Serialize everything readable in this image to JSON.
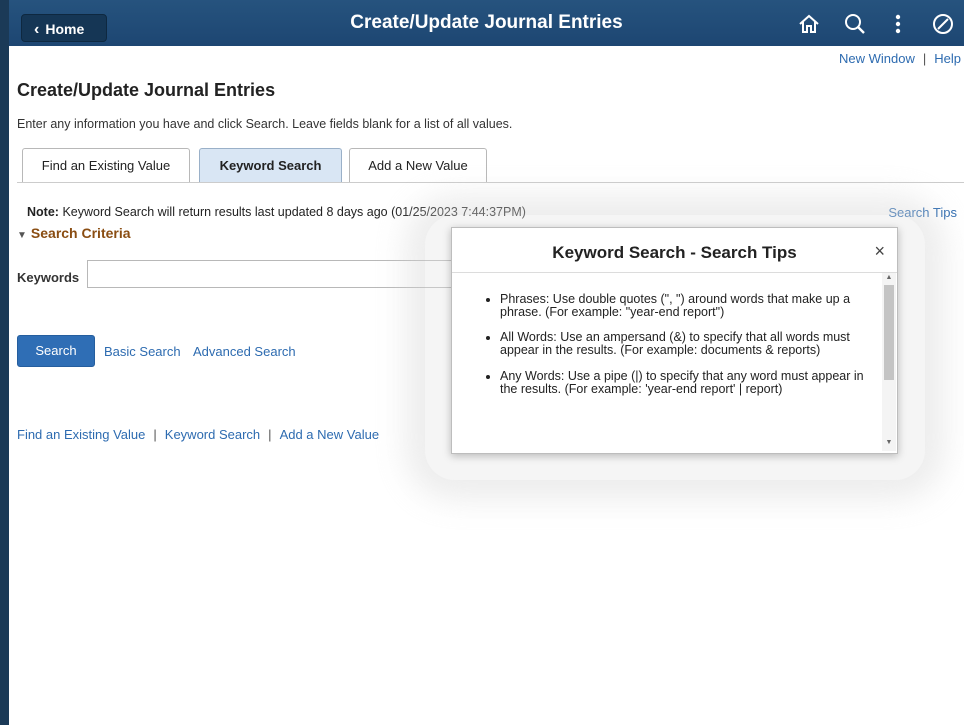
{
  "header": {
    "home_label": "Home",
    "title": "Create/Update Journal Entries",
    "icons": [
      "home-icon",
      "search-icon",
      "actions-menu-icon",
      "navbar-icon"
    ]
  },
  "top_links": {
    "new_window": "New Window",
    "help": "Help",
    "separator": "|"
  },
  "page": {
    "title": "Create/Update Journal Entries",
    "instructions": "Enter any information you have and click Search. Leave fields blank for a list of all values."
  },
  "tabs": [
    {
      "label": "Find an Existing Value",
      "active": false
    },
    {
      "label": "Keyword Search",
      "active": true
    },
    {
      "label": "Add a New Value",
      "active": false
    }
  ],
  "note": {
    "prefix": "Note:",
    "text": "Keyword Search will return results last updated 8 days ago (01/25/2023 7:44:37PM)"
  },
  "search_tips_link": "Search Tips",
  "criteria": {
    "label": "Search Criteria"
  },
  "keywords": {
    "label": "Keywords",
    "value": ""
  },
  "actions": {
    "search": "Search",
    "basic_search": "Basic Search",
    "advanced_search": "Advanced Search"
  },
  "bottom_links": [
    "Find an Existing Value",
    "Keyword Search",
    "Add a New Value"
  ],
  "modal": {
    "title": "Keyword Search - Search Tips",
    "close": "×",
    "tips": [
      "Phrases: Use double quotes (\", \") around words that make up a phrase. (For example: \"year-end report\")",
      "All Words: Use an ampersand (&) to specify that all words must appear in the results. (For example: documents & reports)",
      "Any Words: Use a pipe (|) to specify that any word must appear in the results. (For example: 'year-end report' | report)"
    ]
  },
  "colors": {
    "header": "#1d4672",
    "link": "#2d6bb0",
    "criteria": "#8a4d12",
    "button": "#2f6eb5"
  }
}
